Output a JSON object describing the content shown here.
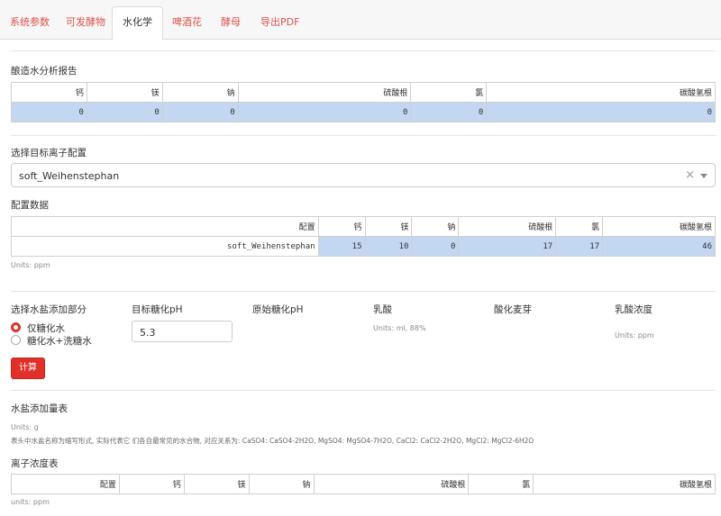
{
  "tabs": [
    "系统参数",
    "可发酵物",
    "水化学",
    "啤酒花",
    "酵母",
    "导出PDF"
  ],
  "active_tab": 2,
  "water_report": {
    "title": "酿造水分析报告",
    "headers": [
      "钙",
      "镁",
      "钠",
      "硫酸根",
      "氯",
      "碳酸氢根"
    ],
    "values": [
      "0",
      "0",
      "0",
      "0",
      "0",
      "0"
    ]
  },
  "target_profile": {
    "title": "选择目标离子配置",
    "selected": "soft_Weihenstephan",
    "clear_icon": "×"
  },
  "profile_data": {
    "title": "配置数据",
    "headers": [
      "配置",
      "钙",
      "镁",
      "钠",
      "硫酸根",
      "氯",
      "碳酸氢根"
    ],
    "row": [
      "soft_Weihenstephan",
      "15",
      "10",
      "0",
      "17",
      "17",
      "46"
    ],
    "units": "Units: ppm"
  },
  "salt_part": {
    "label": "选择水盐添加部分",
    "options": [
      "仅糖化水",
      "糖化水+洗糖水"
    ],
    "selected": 0
  },
  "target_ph": {
    "label": "目标糖化pH",
    "value": "5.3"
  },
  "original_ph": {
    "label": "原始糖化pH"
  },
  "lactic": {
    "label": "乳酸",
    "units": "Units: ml, 88%"
  },
  "acid_malt": {
    "label": "酸化麦芽"
  },
  "lactic_conc": {
    "label": "乳酸浓度",
    "units": "Units: ppm"
  },
  "calc_button": "计算",
  "salt_table": {
    "title": "水盐添加量表",
    "units": "Units: g",
    "note": "表头中水盐名称为缩写形式, 实际代表它 们各自最常见的水合物, 对应关系为: CaSO4: CaSO4-2H2O, MgSO4: MgSO4-7H2O, CaCl2: CaCl2-2H2O, MgCl2: MgCl2-6H2O"
  },
  "ion_table": {
    "title": "离子浓度表",
    "headers": [
      "配置",
      "钙",
      "镁",
      "钠",
      "硫酸根",
      "氯",
      "碳酸氢根"
    ],
    "units": "units: ppm"
  }
}
